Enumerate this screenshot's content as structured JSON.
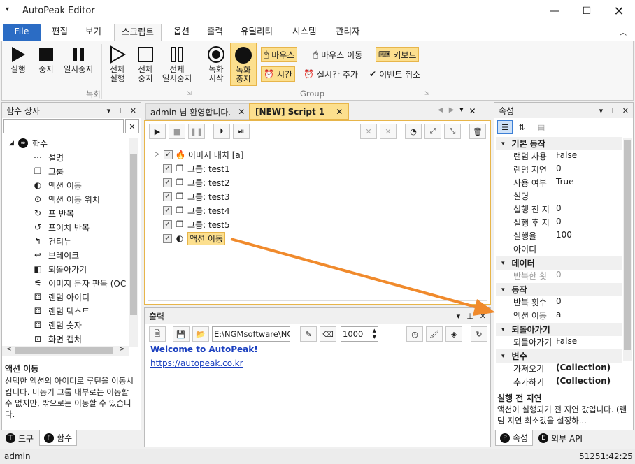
{
  "app": {
    "title": "AutoPeak Editor"
  },
  "menu": {
    "tabs": [
      "File",
      "편집",
      "보기",
      "스크립트",
      "옵션",
      "출력",
      "유틸리티",
      "시스템",
      "관리자"
    ]
  },
  "ribbon": {
    "record_group": {
      "label": "녹화",
      "buttons": [
        "실행",
        "중지",
        "일시중지"
      ]
    },
    "all_buttons": {
      "run": "전체\n실행",
      "stop": "전체\n중지",
      "pause": "전체\n일시중지"
    },
    "rec_start": "녹화\n시작",
    "rec_stop": "녹화\n중지",
    "group": {
      "label": "Group",
      "mouse": "마우스",
      "mouse_move": "마우스 이동",
      "keyboard": "키보드",
      "time": "시간",
      "realtime": "실시간 추가",
      "event_cancel": "이벤트 취소"
    }
  },
  "func_panel": {
    "title": "함수 상자",
    "root": "함수",
    "items": [
      "설명",
      "그룹",
      "액션 이동",
      "액션 이동 위치",
      "포 반복",
      "포이치 반복",
      "컨티뉴",
      "브레이크",
      "되돌아가기",
      "이미지 문자 판독 (OC",
      "랜덤 아이디",
      "랜덤 텍스트",
      "랜덤 숫자",
      "화면 캡쳐"
    ],
    "desc_title": "액션 이동",
    "desc_text": "선택한 액션의 아이디로 루틴을 이동시킵니다. 비동기 그룹 내부로는 이동할 수 없지만, 밖으로는 이동할 수 있습니다.",
    "tabs": [
      "도구",
      "함수"
    ]
  },
  "doc_tabs": [
    "admin 님 환영합니다.",
    "[NEW] Script 1"
  ],
  "script_items": [
    {
      "label": "이미지 매치 [a]"
    },
    {
      "label": "그룹: test1"
    },
    {
      "label": "그룹: test2"
    },
    {
      "label": "그룹: test3"
    },
    {
      "label": "그룹: test4"
    },
    {
      "label": "그룹: test5"
    },
    {
      "label": "액션 이동"
    }
  ],
  "output": {
    "title": "출력",
    "path": "E:\\NGMsoftware\\NG",
    "number": "1000",
    "welcome": "Welcome to AutoPeak!",
    "url": "https://autopeak.co.kr"
  },
  "props": {
    "title": "속성",
    "cats": [
      {
        "name": "기본 동작",
        "rows": [
          [
            "랜덤 사용",
            "False"
          ],
          [
            "랜덤 지연",
            "0"
          ],
          [
            "사용 여부",
            "True"
          ],
          [
            "설명",
            ""
          ],
          [
            "실행 전 지",
            "0"
          ],
          [
            "실행 후 지",
            "0"
          ],
          [
            "실행율",
            "100"
          ],
          [
            "아이디",
            ""
          ]
        ]
      },
      {
        "name": "데이터",
        "rows": [
          [
            "반복한 횟",
            "0"
          ]
        ]
      },
      {
        "name": "동작",
        "rows": [
          [
            "반복 횟수",
            "0"
          ],
          [
            "액션 이동",
            "a"
          ]
        ]
      },
      {
        "name": "되돌아가기",
        "rows": [
          [
            "되돌아가기",
            "False"
          ]
        ]
      },
      {
        "name": "변수",
        "rows": [
          [
            "가져오기",
            "(Collection)"
          ],
          [
            "추가하기",
            "(Collection)"
          ]
        ]
      }
    ],
    "desc_title": "실행 전 지연",
    "desc_text": "액션이 실행되기 전 지연 값입니다. (랜덤 지연 최소값을 설정하...",
    "tabs": [
      "속성",
      "외부 API"
    ]
  },
  "status": {
    "user": "admin",
    "time": "51251:42:25"
  },
  "colors": {
    "accent": "#2b6cc4",
    "highlight": "#fcdf8e",
    "arrow": "#f08a2c",
    "link": "#1a3fbf"
  }
}
